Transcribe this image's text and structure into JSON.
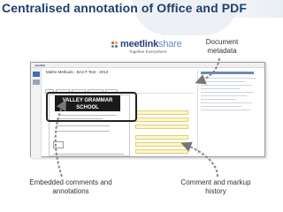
{
  "slide": {
    "title": "Centralised annotation of Office and PDF"
  },
  "logo": {
    "brand_bold": "meetlink",
    "brand_light": "share",
    "tagline": "Together Everywhere"
  },
  "callouts": {
    "metadata": "Document metadata",
    "embedded": "Embedded comments and annotations",
    "markup": "Comment and markup history"
  },
  "screenshot": {
    "doc_title": "Maths Methods - BACT Test - 2013",
    "school_banner": "VALLEY GRAMMAR SCHOOL",
    "colors": {
      "accent": "#3d6fb0",
      "comment": "#fff6c8",
      "banner": "#1a1a1a"
    }
  }
}
